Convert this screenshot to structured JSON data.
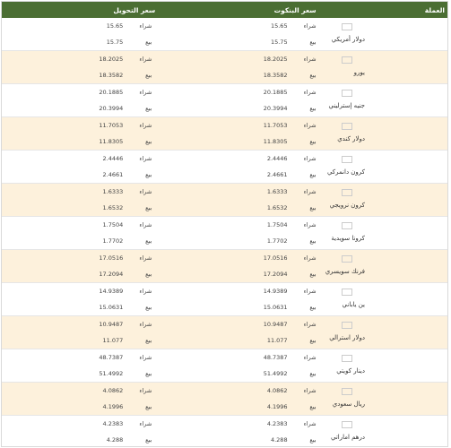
{
  "header": {
    "currency": "العملة",
    "bank_rate": "سعر البنكوت",
    "transfer_rate": "سعر التحويل"
  },
  "labels": {
    "buy": "شراء",
    "sell": "بيع"
  },
  "rows": [
    {
      "flag": "us-flag-icon",
      "name": "دولار أمريكي",
      "bank_buy": "15.65",
      "bank_sell": "15.75",
      "trans_buy": "15.65",
      "trans_sell": "15.75"
    },
    {
      "flag": "eu-flag-icon",
      "name": "يورو",
      "bank_buy": "18.2025",
      "bank_sell": "18.3582",
      "trans_buy": "18.2025",
      "trans_sell": "18.3582"
    },
    {
      "flag": "uk-flag-icon",
      "name": "جنيه إسترليني",
      "bank_buy": "20.1885",
      "bank_sell": "20.3994",
      "trans_buy": "20.1885",
      "trans_sell": "20.3994"
    },
    {
      "flag": "ca-flag-icon",
      "name": "دولار كندي",
      "bank_buy": "11.7053",
      "bank_sell": "11.8305",
      "trans_buy": "11.7053",
      "trans_sell": "11.8305"
    },
    {
      "flag": "dk-flag-icon",
      "name": "كرون دانمركي",
      "bank_buy": "2.4446",
      "bank_sell": "2.4661",
      "trans_buy": "2.4446",
      "trans_sell": "2.4661"
    },
    {
      "flag": "no-flag-icon",
      "name": "كرون نرويجي",
      "bank_buy": "1.6333",
      "bank_sell": "1.6532",
      "trans_buy": "1.6333",
      "trans_sell": "1.6532"
    },
    {
      "flag": "se-flag-icon",
      "name": "كرونا سويدية",
      "bank_buy": "1.7504",
      "bank_sell": "1.7702",
      "trans_buy": "1.7504",
      "trans_sell": "1.7702"
    },
    {
      "flag": "ch-flag-icon",
      "name": "فرنك سويسري",
      "bank_buy": "17.0516",
      "bank_sell": "17.2094",
      "trans_buy": "17.0516",
      "trans_sell": "17.2094"
    },
    {
      "flag": "jp-flag-icon",
      "name": "ين ياباني",
      "bank_buy": "14.9389",
      "bank_sell": "15.0631",
      "trans_buy": "14.9389",
      "trans_sell": "15.0631"
    },
    {
      "flag": "au-flag-icon",
      "name": "دولار استرالي",
      "bank_buy": "10.9487",
      "bank_sell": "11.077",
      "trans_buy": "10.9487",
      "trans_sell": "11.077"
    },
    {
      "flag": "kw-flag-icon",
      "name": "دينار كويتي",
      "bank_buy": "48.7387",
      "bank_sell": "51.4992",
      "trans_buy": "48.7387",
      "trans_sell": "51.4992"
    },
    {
      "flag": "sa-flag-icon",
      "name": "ريال سعودي",
      "bank_buy": "4.0862",
      "bank_sell": "4.1996",
      "trans_buy": "4.0862",
      "trans_sell": "4.1996"
    },
    {
      "flag": "ae-flag-icon",
      "name": "درهم اماراتي",
      "bank_buy": "4.2383",
      "bank_sell": "4.288",
      "trans_buy": "4.2383",
      "trans_sell": "4.288"
    }
  ]
}
